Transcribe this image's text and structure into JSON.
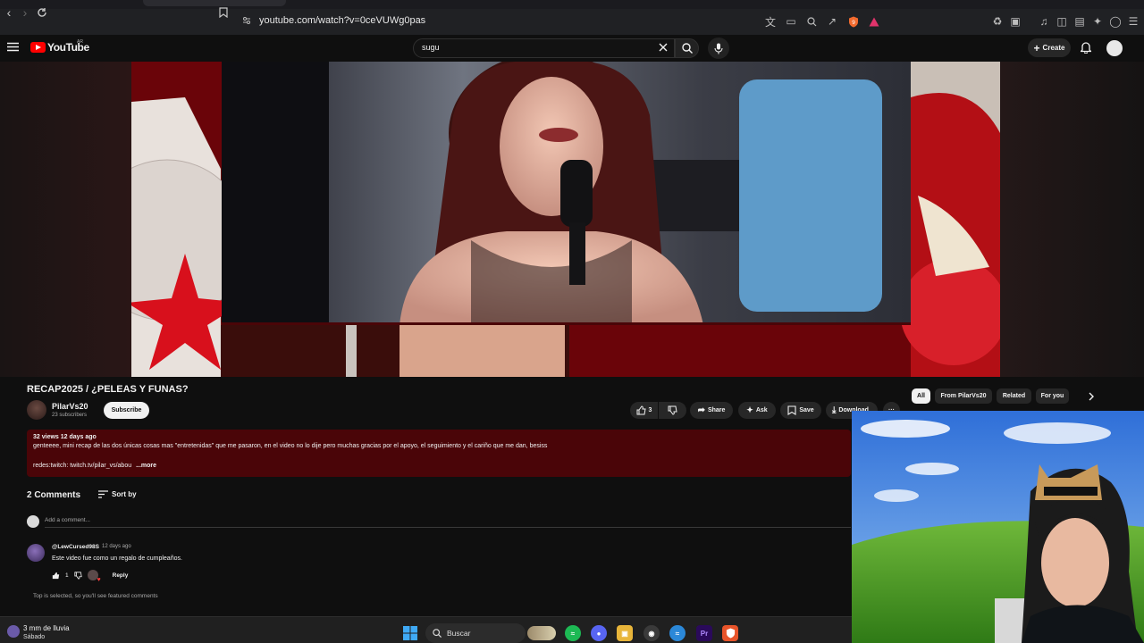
{
  "browser": {
    "url": "youtube.com/watch?v=0ceVUWg0pas"
  },
  "youtube": {
    "logo_text": "YouTube",
    "country_code": "AR",
    "search_query": "sugu",
    "create_label": "Create"
  },
  "video": {
    "title": "RECAP2025 / ¿PELEAS Y FUNAS?",
    "channel_name": "PilarVs20",
    "subscribers": "23 subscribers",
    "subscribe_label": "Subscribe",
    "likes": "3",
    "share_label": "Share",
    "ask_label": "Ask",
    "save_label": "Save",
    "download_label": "Download",
    "more_label": "···"
  },
  "description": {
    "stats": "32 views  12 days ago",
    "line1": "genteeee, mini recap de las dos únicas cosas mas \"entretenidas\" que me pasaron, en el video no lo dije pero muchas gracias por el apoyo, el seguimiento y el cariño que me dan, besiss",
    "line2": "redes:twitch: twitch.tv/pilar_vs/abou",
    "more": "...more"
  },
  "comments": {
    "count_label": "2 Comments",
    "sort_label": "Sort by",
    "add_placeholder": "Add a comment...",
    "items": [
      {
        "author": "@LewCursed98S",
        "time": "12 days ago",
        "text": "Este video fue como un regalo de cumpleaños.",
        "likes": "1",
        "reply_label": "Reply"
      }
    ],
    "featured_note": "Top is selected, so you'll see featured comments"
  },
  "chips": {
    "all": "All",
    "from_channel": "From PilarVs20",
    "related": "Related",
    "for_you": "For you"
  },
  "taskbar": {
    "weather_title": "3 mm de lluvia",
    "weather_day": "Sábado",
    "search_label": "Buscar",
    "premiere_label": "Pr"
  },
  "colors": {
    "yt_red": "#ff0000",
    "description_bg": "#4a0508",
    "background": "#0f0f0f"
  }
}
